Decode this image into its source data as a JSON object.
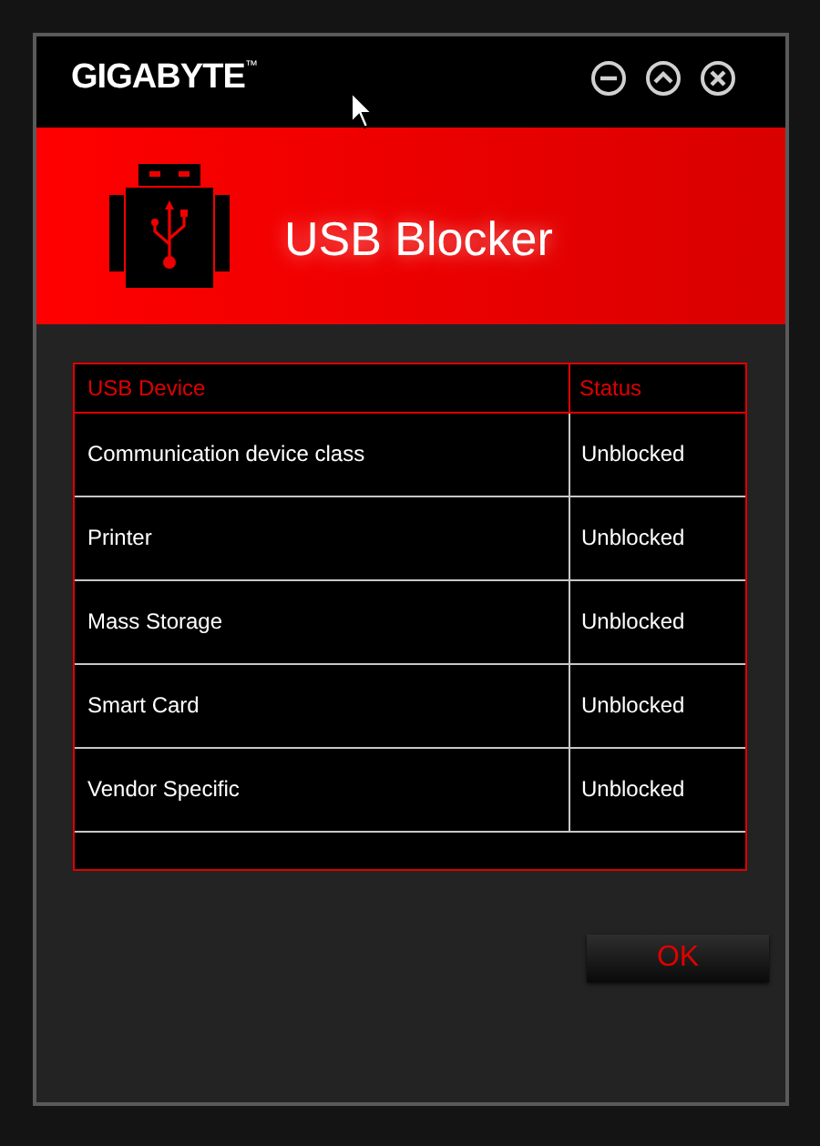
{
  "window": {
    "logo": "GIGABYTE",
    "logo_mark": "™",
    "title": "USB Blocker"
  },
  "table": {
    "columns": [
      "USB Device",
      "Status"
    ],
    "rows": [
      {
        "device": "Communication device class",
        "status": "Unblocked"
      },
      {
        "device": "Printer",
        "status": "Unblocked"
      },
      {
        "device": "Mass Storage",
        "status": "Unblocked"
      },
      {
        "device": "Smart Card",
        "status": "Unblocked"
      },
      {
        "device": "Vendor Specific",
        "status": "Unblocked"
      }
    ]
  },
  "buttons": [
    "OK"
  ]
}
